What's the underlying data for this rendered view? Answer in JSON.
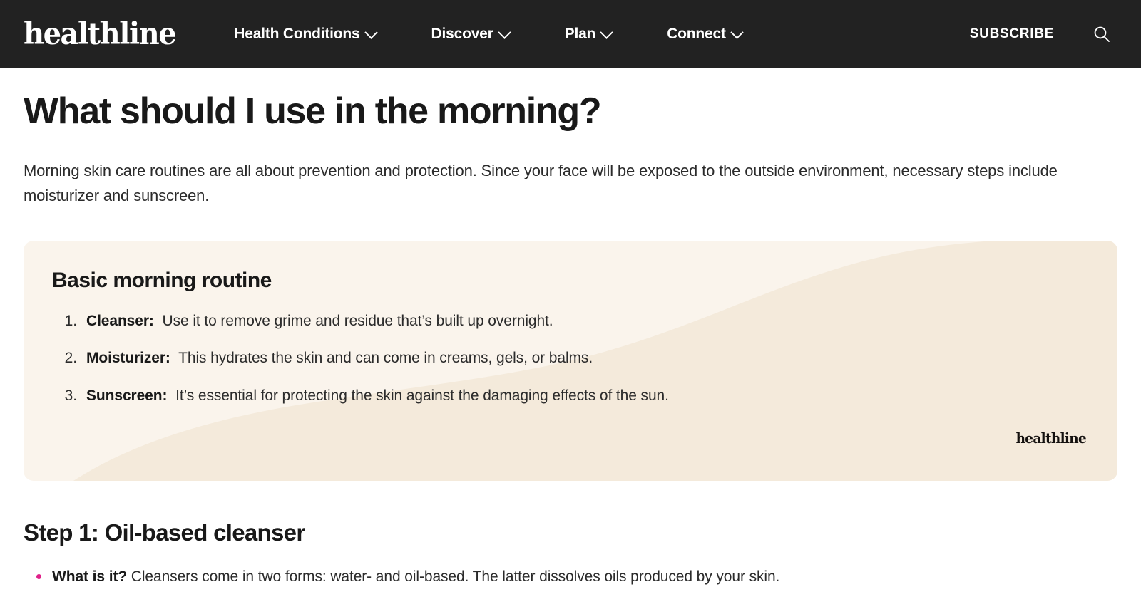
{
  "header": {
    "brand": "healthline",
    "nav_items": [
      {
        "label": "Health Conditions",
        "icon": "chevron-down-icon"
      },
      {
        "label": "Discover",
        "icon": "chevron-down-icon"
      },
      {
        "label": "Plan",
        "icon": "chevron-down-icon"
      },
      {
        "label": "Connect",
        "icon": "chevron-down-icon"
      }
    ],
    "subscribe_label": "SUBSCRIBE",
    "search_icon": "search-icon",
    "background_color": "#222222",
    "text_color": "#ffffff"
  },
  "article": {
    "title": "What should I use in the morning?",
    "intro": "Morning skin care routines are all about prevention and protection. Since your face will be exposed to the outside environment, necessary steps include moisturizer and sunscreen."
  },
  "callout": {
    "title": "Basic morning routine",
    "background_color": "#FAF4EC",
    "wave_color": "#F4EADB",
    "logo": "healthline",
    "items": [
      {
        "number": "1.",
        "lead": "Cleanser:",
        "text": "Use it to remove grime and residue that’s built up overnight."
      },
      {
        "number": "2.",
        "lead": "Moisturizer:",
        "text": "This hydrates the skin and can come in creams, gels, or balms."
      },
      {
        "number": "3.",
        "lead": "Sunscreen:",
        "text": "It’s essential for protecting the skin against the damaging effects of the sun."
      }
    ]
  },
  "step_section": {
    "title": "Step 1: Oil-based cleanser",
    "bullet_color": "#E0218A",
    "bullets": [
      {
        "lead": "What is it?",
        "text": "Cleansers come in two forms: water- and oil-based. The latter dissolves oils produced by your skin."
      }
    ]
  }
}
